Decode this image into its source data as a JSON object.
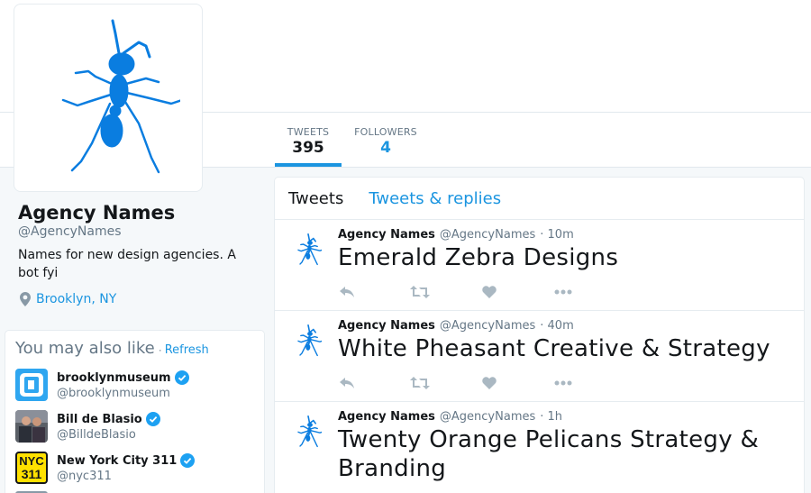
{
  "profile": {
    "name": "Agency Names",
    "handle": "@AgencyNames",
    "bio": "Names for new design agencies. A bot fyi",
    "location": "Brooklyn, NY",
    "avatar_icon": "ant-icon",
    "accent": "#1b95e0",
    "avatar_color": "#0a7de0"
  },
  "stats": {
    "tweets_label": "TWEETS",
    "tweets_value": "395",
    "followers_label": "FOLLOWERS",
    "followers_value": "4"
  },
  "suggestions": {
    "title": "You may also like",
    "dot": "·",
    "refresh": "Refresh",
    "items": [
      {
        "name": "brooklynmuseum",
        "handle": "@brooklynmuseum",
        "icon": "brooklyn-museum-logo"
      },
      {
        "name": "Bill de Blasio",
        "handle": "@BilldeBlasio",
        "icon": "person-photo"
      },
      {
        "name": "New York City 311",
        "handle": "@nyc311",
        "icon": "nyc311-logo",
        "logo_text_1": "NYC",
        "logo_text_2": "311"
      }
    ]
  },
  "timeline": {
    "tabs": [
      "Tweets",
      "Tweets & replies"
    ],
    "tweets": [
      {
        "author": "Agency Names",
        "handle": "@AgencyNames",
        "time": "· 10m",
        "text": "Emerald Zebra Designs"
      },
      {
        "author": "Agency Names",
        "handle": "@AgencyNames",
        "time": "· 40m",
        "text": "White Pheasant Creative & Strategy"
      },
      {
        "author": "Agency Names",
        "handle": "@AgencyNames",
        "time": "· 1h",
        "text": "Twenty Orange Pelicans Strategy & Branding"
      }
    ]
  }
}
